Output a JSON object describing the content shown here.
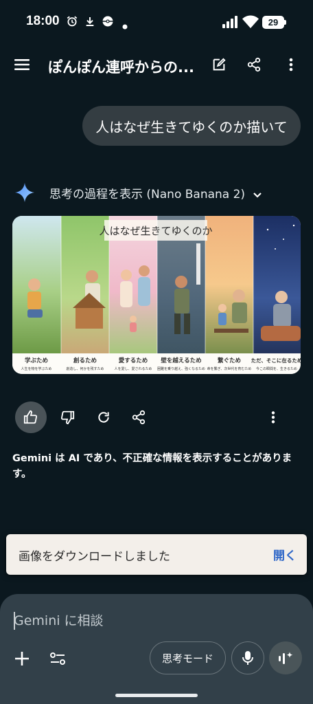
{
  "status_bar": {
    "time": "18:00",
    "battery": "29",
    "icons": [
      "alarm-icon",
      "download-icon",
      "pokeball-icon",
      "dot-icon",
      "signal-icon",
      "wifi-icon",
      "battery-icon"
    ]
  },
  "app_bar": {
    "title": "ぽんぽん連呼からの...",
    "icons": [
      "menu-icon",
      "edit-icon",
      "share-icon",
      "more-vert-icon"
    ]
  },
  "conversation": {
    "user_prompt": "人はなぜ生きてゆくのか描いて",
    "thinking_label": "思考の過程を表示 (Nano Banana 2)",
    "image": {
      "title": "人はなぜ生きてゆくのか",
      "panels": [
        {
          "caption": "学ぶため",
          "sub": "人生を物を学ぶため"
        },
        {
          "caption": "創るため",
          "sub": "創造し、何かを残すため"
        },
        {
          "caption": "愛するため",
          "sub": "人を愛し、愛されるため"
        },
        {
          "caption": "壁を越えるため",
          "sub": "困難を乗り越え、強くなるため"
        },
        {
          "caption": "繋ぐため",
          "sub": "命を繋ぎ、次世代を育むため"
        },
        {
          "caption": "ただ、そこに在るため",
          "sub": "今この瞬間を、生きるため"
        }
      ]
    },
    "actions": [
      "thumb-up-icon",
      "thumb-down-icon",
      "refresh-icon",
      "share-icon",
      "more-vert-icon"
    ],
    "disclaimer": "Gemini は AI であり、不正確な情報を表示することがあります。"
  },
  "snackbar": {
    "message": "画像をダウンロードしました",
    "action": "開く"
  },
  "composer": {
    "placeholder": "Gemini に相談",
    "mode_label": "思考モード",
    "icons": [
      "plus-icon",
      "tools-icon",
      "mic-icon",
      "live-icon"
    ]
  },
  "colors": {
    "background": "#0b181f",
    "bubble": "#343d42",
    "composer": "#324049",
    "snackbar": "#f3efea",
    "snackbar_action": "#2f67c8",
    "sparkle": "#6fb0f5"
  }
}
